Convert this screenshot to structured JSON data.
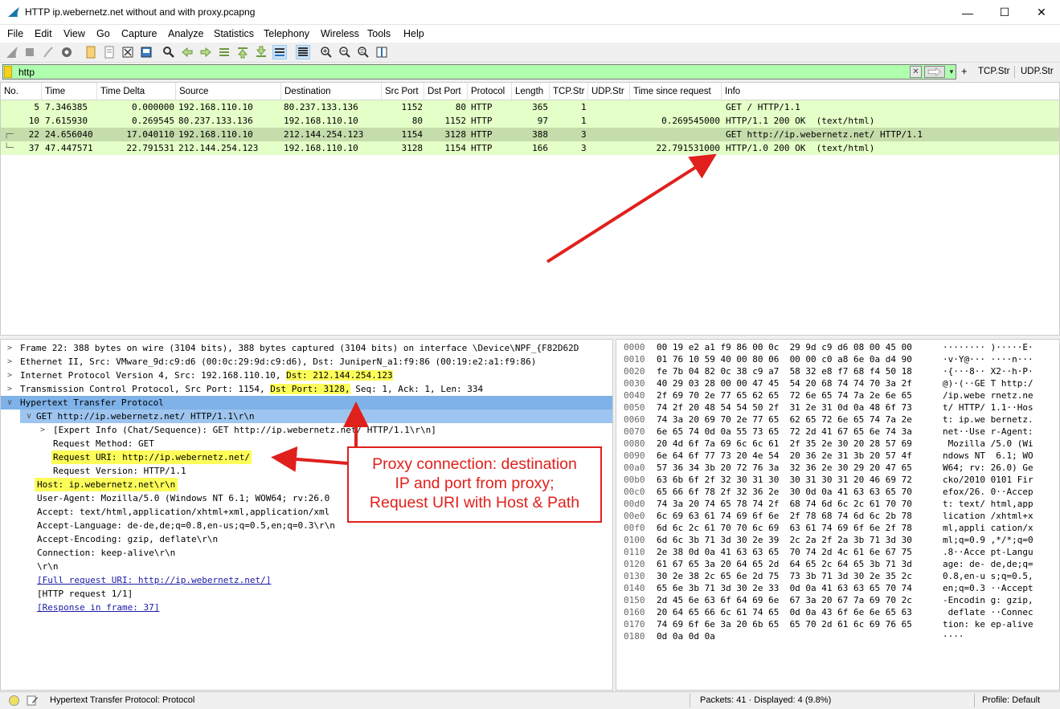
{
  "window": {
    "title": "HTTP ip.webernetz.net without and with proxy.pcapng",
    "minimize": "—",
    "maximize": "☐",
    "close": "✕"
  },
  "menu": [
    "File",
    "Edit",
    "View",
    "Go",
    "Capture",
    "Analyze",
    "Statistics",
    "Telephony",
    "Wireless",
    "Tools",
    "Help"
  ],
  "toolbar": {
    "icons": [
      "shark-fin-start-icon",
      "stop-capture-icon",
      "restart-capture-icon",
      "capture-options-icon",
      "open-file-icon",
      "save-file-icon",
      "close-file-icon",
      "reload-file-icon",
      "find-packet-icon",
      "go-back-icon",
      "go-forward-icon",
      "go-to-packet-icon",
      "go-first-icon",
      "go-last-icon",
      "autoscroll-icon",
      "colorize-icon",
      "zoom-in-icon",
      "zoom-out-icon",
      "normal-size-icon",
      "resize-columns-icon"
    ]
  },
  "filter": {
    "value": "http",
    "clear": "✕",
    "add": "+",
    "buttons": [
      "TCP.Str",
      "UDP.Str"
    ]
  },
  "packet_list": {
    "columns": [
      "No.",
      "Time",
      "Time Delta",
      "Source",
      "Destination",
      "Src Port",
      "Dst Port",
      "Protocol",
      "Length",
      "TCP.Str",
      "UDP.Str",
      "Time since request",
      "Info"
    ],
    "rows": [
      {
        "no": "5",
        "time": "7.346385",
        "delta": "0.000000",
        "src": "192.168.110.10",
        "dst": "80.237.133.136",
        "sport": "1152",
        "dport": "80",
        "proto": "HTTP",
        "len": "365",
        "tcpstr": "1",
        "udpstr": "",
        "tsr": "",
        "info": "GET / HTTP/1.1"
      },
      {
        "no": "10",
        "time": "7.615930",
        "delta": "0.269545",
        "src": "80.237.133.136",
        "dst": "192.168.110.10",
        "sport": "80",
        "dport": "1152",
        "proto": "HTTP",
        "len": "97",
        "tcpstr": "1",
        "udpstr": "",
        "tsr": "0.269545000",
        "info": "HTTP/1.1 200 OK  (text/html)"
      },
      {
        "no": "22",
        "time": "24.656040",
        "delta": "17.040110",
        "src": "192.168.110.10",
        "dst": "212.144.254.123",
        "sport": "1154",
        "dport": "3128",
        "proto": "HTTP",
        "len": "388",
        "tcpstr": "3",
        "udpstr": "",
        "tsr": "",
        "info": "GET http://ip.webernetz.net/ HTTP/1.1"
      },
      {
        "no": "37",
        "time": "47.447571",
        "delta": "22.791531",
        "src": "212.144.254.123",
        "dst": "192.168.110.10",
        "sport": "3128",
        "dport": "1154",
        "proto": "HTTP",
        "len": "166",
        "tcpstr": "3",
        "udpstr": "",
        "tsr": "22.791531000",
        "info": "HTTP/1.0 200 OK  (text/html)"
      }
    ]
  },
  "details": {
    "frame": "Frame 22: 388 bytes on wire (3104 bits), 388 bytes captured (3104 bits) on interface \\Device\\NPF_{F82D62D",
    "ethernet": "Ethernet II, Src: VMware_9d:c9:d6 (00:0c:29:9d:c9:d6), Dst: JuniperN_a1:f9:86 (00:19:e2:a1:f9:86)",
    "ip_pre": "Internet Protocol Version 4, Src: 192.168.110.10, ",
    "ip_hl": "Dst: 212.144.254.123",
    "tcp_pre": "Transmission Control Protocol, Src Port: 1154, ",
    "tcp_hl": "Dst Port: 3128,",
    "tcp_post": " Seq: 1, Ack: 1, Len: 334",
    "http": "Hypertext Transfer Protocol",
    "get": "GET http://ip.webernetz.net/ HTTP/1.1\\r\\n",
    "expert": "[Expert Info (Chat/Sequence): GET http://ip.webernetz.net/ HTTP/1.1\\r\\n]",
    "method": "Request Method: GET",
    "uri": "Request URI: http://ip.webernetz.net/",
    "version": "Request Version: HTTP/1.1",
    "host": "Host: ip.webernetz.net\\r\\n",
    "useragent": "User-Agent: Mozilla/5.0 (Windows NT 6.1; WOW64; rv:26.0",
    "accept": "Accept: text/html,application/xhtml+xml,application/xml",
    "accept_lang": "Accept-Language: de-de,de;q=0.8,en-us;q=0.5,en;q=0.3\\r\\n",
    "accept_enc": "Accept-Encoding: gzip, deflate\\r\\n",
    "connection": "Connection: keep-alive\\r\\n",
    "crlf": "\\r\\n",
    "full_uri": "[Full request URI: http://ip.webernetz.net/]",
    "http_req": "[HTTP request 1/1]",
    "response_in": "[Response in frame: 37]"
  },
  "bytes": [
    {
      "off": "0000",
      "hex": "00 19 e2 a1 f9 86 00 0c  29 9d c9 d6 08 00 45 00",
      "asc": "········ )·····E·"
    },
    {
      "off": "0010",
      "hex": "01 76 10 59 40 00 80 06  00 00 c0 a8 6e 0a d4 90",
      "asc": "·v·Y@··· ····n···"
    },
    {
      "off": "0020",
      "hex": "fe 7b 04 82 0c 38 c9 a7  58 32 e8 f7 68 f4 50 18",
      "asc": "·{···8·· X2··h·P·"
    },
    {
      "off": "0030",
      "hex": "40 29 03 28 00 00 47 45  54 20 68 74 74 70 3a 2f",
      "asc": "@)·(··GE T http:/"
    },
    {
      "off": "0040",
      "hex": "2f 69 70 2e 77 65 62 65  72 6e 65 74 7a 2e 6e 65",
      "asc": "/ip.webe rnetz.ne"
    },
    {
      "off": "0050",
      "hex": "74 2f 20 48 54 54 50 2f  31 2e 31 0d 0a 48 6f 73",
      "asc": "t/ HTTP/ 1.1··Hos"
    },
    {
      "off": "0060",
      "hex": "74 3a 20 69 70 2e 77 65  62 65 72 6e 65 74 7a 2e",
      "asc": "t: ip.we bernetz."
    },
    {
      "off": "0070",
      "hex": "6e 65 74 0d 0a 55 73 65  72 2d 41 67 65 6e 74 3a",
      "asc": "net··Use r-Agent:"
    },
    {
      "off": "0080",
      "hex": "20 4d 6f 7a 69 6c 6c 61  2f 35 2e 30 20 28 57 69",
      "asc": " Mozilla /5.0 (Wi"
    },
    {
      "off": "0090",
      "hex": "6e 64 6f 77 73 20 4e 54  20 36 2e 31 3b 20 57 4f",
      "asc": "ndows NT  6.1; WO"
    },
    {
      "off": "00a0",
      "hex": "57 36 34 3b 20 72 76 3a  32 36 2e 30 29 20 47 65",
      "asc": "W64; rv: 26.0) Ge"
    },
    {
      "off": "00b0",
      "hex": "63 6b 6f 2f 32 30 31 30  30 31 30 31 20 46 69 72",
      "asc": "cko/2010 0101 Fir"
    },
    {
      "off": "00c0",
      "hex": "65 66 6f 78 2f 32 36 2e  30 0d 0a 41 63 63 65 70",
      "asc": "efox/26. 0··Accep"
    },
    {
      "off": "00d0",
      "hex": "74 3a 20 74 65 78 74 2f  68 74 6d 6c 2c 61 70 70",
      "asc": "t: text/ html,app"
    },
    {
      "off": "00e0",
      "hex": "6c 69 63 61 74 69 6f 6e  2f 78 68 74 6d 6c 2b 78",
      "asc": "lication /xhtml+x"
    },
    {
      "off": "00f0",
      "hex": "6d 6c 2c 61 70 70 6c 69  63 61 74 69 6f 6e 2f 78",
      "asc": "ml,appli cation/x"
    },
    {
      "off": "0100",
      "hex": "6d 6c 3b 71 3d 30 2e 39  2c 2a 2f 2a 3b 71 3d 30",
      "asc": "ml;q=0.9 ,*/*;q=0"
    },
    {
      "off": "0110",
      "hex": "2e 38 0d 0a 41 63 63 65  70 74 2d 4c 61 6e 67 75",
      "asc": ".8··Acce pt-Langu"
    },
    {
      "off": "0120",
      "hex": "61 67 65 3a 20 64 65 2d  64 65 2c 64 65 3b 71 3d",
      "asc": "age: de- de,de;q="
    },
    {
      "off": "0130",
      "hex": "30 2e 38 2c 65 6e 2d 75  73 3b 71 3d 30 2e 35 2c",
      "asc": "0.8,en-u s;q=0.5,"
    },
    {
      "off": "0140",
      "hex": "65 6e 3b 71 3d 30 2e 33  0d 0a 41 63 63 65 70 74",
      "asc": "en;q=0.3 ··Accept"
    },
    {
      "off": "0150",
      "hex": "2d 45 6e 63 6f 64 69 6e  67 3a 20 67 7a 69 70 2c",
      "asc": "-Encodin g: gzip,"
    },
    {
      "off": "0160",
      "hex": "20 64 65 66 6c 61 74 65  0d 0a 43 6f 6e 6e 65 63",
      "asc": " deflate ··Connec"
    },
    {
      "off": "0170",
      "hex": "74 69 6f 6e 3a 20 6b 65  65 70 2d 61 6c 69 76 65",
      "asc": "tion: ke ep-alive"
    },
    {
      "off": "0180",
      "hex": "0d 0a 0d 0a",
      "asc": "····"
    }
  ],
  "status": {
    "text": "Hypertext Transfer Protocol: Protocol",
    "packets": "Packets: 41 · Displayed: 4 (9.8%)",
    "profile": "Profile: Default"
  },
  "annotation": {
    "line1": "Proxy connection: destination",
    "line2": "IP and port from proxy;",
    "line3": "Request URI with Host & Path",
    "color": "#e0201c"
  }
}
